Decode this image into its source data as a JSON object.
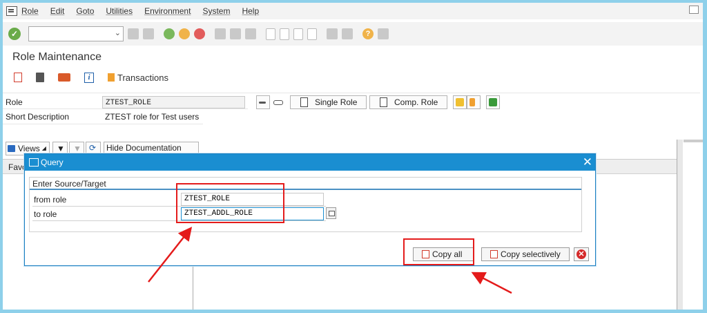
{
  "menu": {
    "items": [
      "Role",
      "Edit",
      "Goto",
      "Utilities",
      "Environment",
      "System",
      "Help"
    ]
  },
  "toolbar": {
    "command_field_value": "",
    "icons": [
      "enter-icon",
      "back-icon",
      "exit-icon",
      "cancel-icon",
      "print-icon",
      "find-icon",
      "find-next-icon",
      "first-page-icon",
      "prev-page-icon",
      "next-page-icon",
      "last-page-icon",
      "create-session-icon",
      "shortcut-icon",
      "help-icon",
      "customize-icon"
    ]
  },
  "page": {
    "title": "Role Maintenance",
    "transactions_label": "Transactions"
  },
  "role_header": {
    "role_label": "Role",
    "role_value": "ZTEST_ROLE",
    "short_desc_label": "Short Description",
    "short_desc_value": "ZTEST role for Test users",
    "single_role_label": "Single Role",
    "comp_role_label": "Comp. Role"
  },
  "lower_toolbar": {
    "views_label": "Views",
    "hide_doc_label": "Hide Documentation"
  },
  "grid": {
    "header_label": "Favo"
  },
  "dialog": {
    "title": "Query",
    "group_title": "Enter Source/Target",
    "from_label": "from role",
    "from_value": "ZTEST_ROLE",
    "to_label": "to role",
    "to_value": "ZTEST_ADDL_ROLE",
    "copy_all_label": "Copy all",
    "copy_selectively_label": "Copy selectively"
  },
  "colors": {
    "dialog_titlebar": "#1a8ed1",
    "highlight": "#e41b1b",
    "background_border": "#8ed0ea"
  }
}
